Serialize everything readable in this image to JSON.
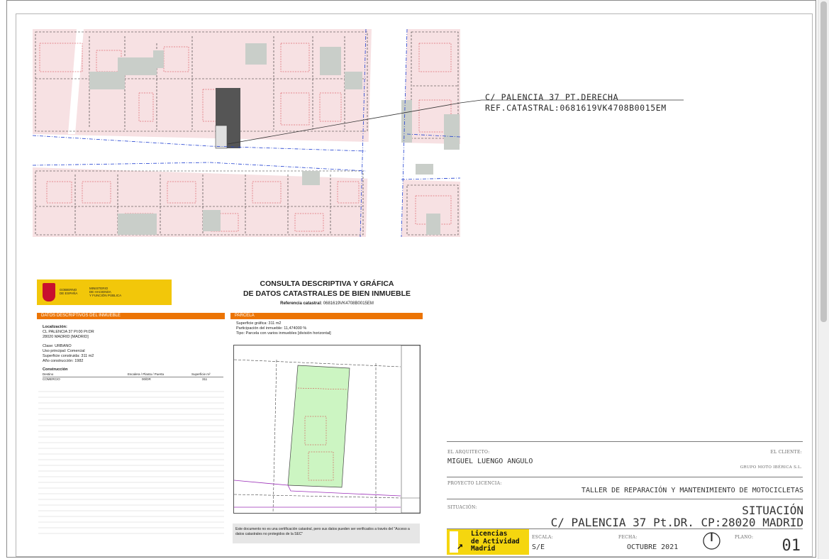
{
  "callout": {
    "address": "C/ PALENCIA 37 PT.DERECHA",
    "reference": "REF.CATASTRAL:0681619VK4708B0015EM"
  },
  "certificate": {
    "title_line1": "CONSULTA DESCRIPTIVA Y GRÁFICA",
    "title_line2": "DE DATOS CATASTRALES DE BIEN INMUEBLE",
    "reference_label": "Referencia catastral:",
    "reference_value": "0681619VK4708B0015EM",
    "gov_line1": "GOBIERNO",
    "gov_line2": "DE ESPAÑA",
    "ministry_line1": "MINISTERIO",
    "ministry_line2": "DE HACIENDA",
    "ministry_line3": "Y FUNCIÓN PÚBLICA",
    "left_header": "DATOS DESCRIPTIVOS DEL INMUEBLE",
    "right_header": "PARCELA",
    "localizacion_label": "Localización:",
    "localizacion_line1": "CL PALENCIA 37 Pl:00 Pt:DR",
    "localizacion_line2": "28020 MADRID [MADRID]",
    "clase": "Clase: URBANO",
    "uso": "Uso principal: Comercial",
    "superficie_construida": "Superficie construida: 311 m2",
    "ano": "Año construcción: 1982",
    "construccion_label": "Construcción",
    "col_destino": "Destino",
    "col_escalera": "Escalera / Planta / Puerta",
    "col_superficie": "Superficie m²",
    "row_destino": "COMERCIO",
    "row_planta": "00/DR",
    "row_superficie": "311",
    "superficie_grafica": "Superficie gráfica: 311 m2",
    "participacion": "Participación del inmueble: 11,474000 %",
    "tipo": "Tipo: Parcela con varios inmuebles [división horizontal]",
    "footnote": "Este documento no es una certificación catastral, pero sus datos pueden ser verificados a través del \"Acceso a datos catastrales no protegidos de la SEC\""
  },
  "title_block": {
    "architect_label": "EL ARQUITECTO:",
    "architect_name": "MIGUEL LUENGO ANGULO",
    "client_label": "EL CLIENTE:",
    "client_name": "GRUPO MOTO IBÉRICA S.L.",
    "project_label": "PROYECTO LICENCIA:",
    "project_name": "TALLER DE REPARACIÓN Y MANTENIMIENTO DE MOTOCICLETAS",
    "situation_label": "SITUACIÓN:",
    "situation_title": "SITUACIÓN",
    "situation_address": "C/ PALENCIA 37 Pt.DR. CP:28020 MADRID",
    "logo_text": "Licencias\nde Actividad\nMadrid",
    "scale_label": "ESCALA:",
    "scale_value": "S/E",
    "date_label": "FECHA:",
    "date_value": "OCTUBRE 2021",
    "plan_label": "PLANO:",
    "plan_value": "01",
    "north_icon": "north-arrow-icon"
  },
  "colors": {
    "map_background": "#f7e1e3",
    "highlight_plot": "#555555",
    "orange": "#ec7404",
    "parcel_green": "#ccf5c2",
    "logo_yellow": "#f5d60f"
  }
}
